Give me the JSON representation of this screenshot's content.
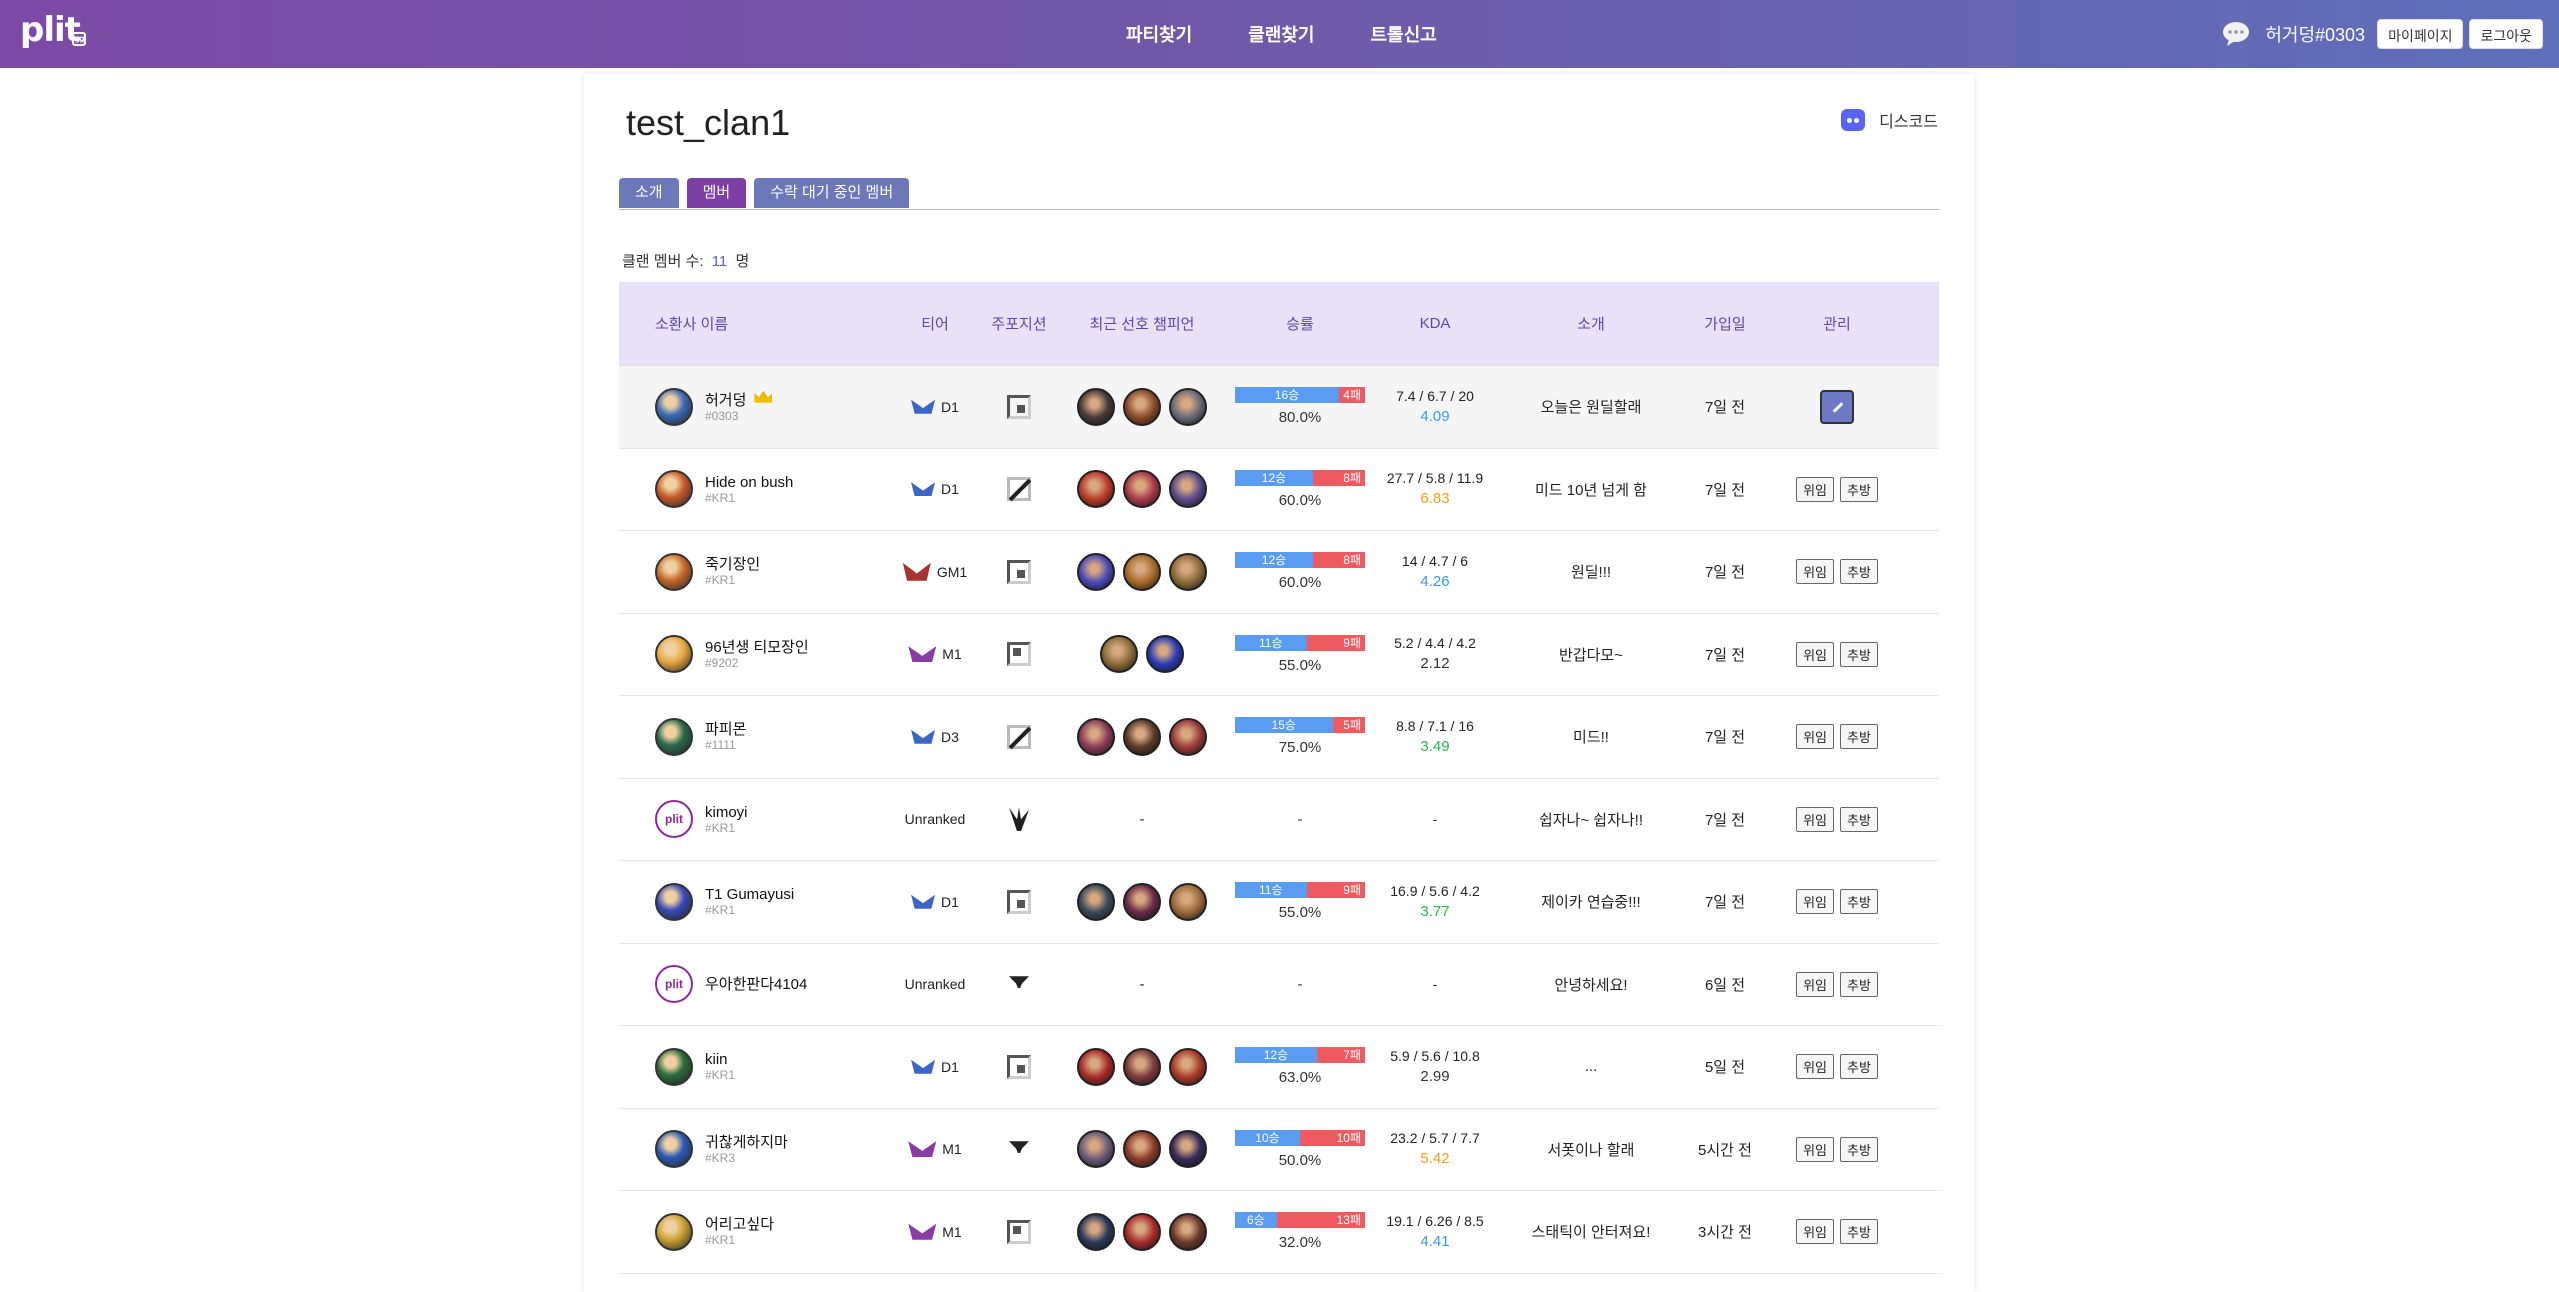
{
  "header": {
    "logo": "plit",
    "logo_sub": "gg",
    "nav": [
      "파티찾기",
      "클랜찾기",
      "트롤신고"
    ],
    "user": "허거덩#0303",
    "mypage": "마이페이지",
    "logout": "로그아웃"
  },
  "clan": {
    "title": "test_clan1",
    "discord": "디스코드",
    "tabs": [
      "소개",
      "멤버",
      "수락 대기 중인 멤버"
    ],
    "count_label": "클랜 멤버 수:",
    "count": "11",
    "count_unit": "명"
  },
  "table": {
    "headers": [
      "소환사 이름",
      "티어",
      "주포지션",
      "최근 선호 챔피언",
      "승률",
      "KDA",
      "소개",
      "가입일",
      "관리"
    ],
    "buttons": {
      "delegate": "위임",
      "kick": "추방"
    },
    "rows": [
      {
        "name": "허거덩",
        "tag": "#0303",
        "tier": "D1",
        "tier_type": "dia",
        "pos": "top",
        "champs": [
          "#4a3a3a",
          "#8a4a2a",
          "#6a6a7a"
        ],
        "win": "16승",
        "loss": "4패",
        "win_frac": 0.8,
        "rate": "80.0%",
        "kda": "7.4 / 6.7 / 20",
        "ratio": "4.09",
        "ratio_color": "#3a9ad9",
        "intro": "오늘은 원딜할래",
        "join": "7일 전",
        "owner": true,
        "avatar": "#3a6ab8"
      },
      {
        "name": "Hide on bush",
        "tag": "#KR1",
        "tier": "D1",
        "tier_type": "dia",
        "pos": "mid",
        "champs": [
          "#b83a2a",
          "#a83a4a",
          "#5a4a8a"
        ],
        "win": "12승",
        "loss": "8패",
        "win_frac": 0.6,
        "rate": "60.0%",
        "kda": "27.7 / 5.8 / 11.9",
        "ratio": "6.83",
        "ratio_color": "#f0a020",
        "intro": "미드 10년 넘게 함",
        "join": "7일 전",
        "owner": false,
        "avatar": "#c85a2a"
      },
      {
        "name": "죽기장인",
        "tag": "#KR1",
        "tier": "GM1",
        "tier_type": "gm",
        "pos": "top",
        "champs": [
          "#4a4ab8",
          "#a86a2a",
          "#8a6a3a"
        ],
        "win": "12승",
        "loss": "8패",
        "win_frac": 0.6,
        "rate": "60.0%",
        "kda": "14 / 4.7 / 6",
        "ratio": "4.26",
        "ratio_color": "#3a9ad9",
        "intro": "원딜!!!",
        "join": "7일 전",
        "owner": false,
        "avatar": "#c86a2a"
      },
      {
        "name": "96년생 티모장인",
        "tag": "#9202",
        "tier": "M1",
        "tier_type": "mas",
        "pos": "bot",
        "champs": [
          "#8a6a3a",
          "#2a3ab8"
        ],
        "win": "11승",
        "loss": "9패",
        "win_frac": 0.55,
        "rate": "55.0%",
        "kda": "5.2 / 4.4 / 4.2",
        "ratio": "2.12",
        "ratio_color": "#333333",
        "intro": "반갑다모~",
        "join": "7일 전",
        "owner": false,
        "avatar": "#e8a840"
      },
      {
        "name": "파피몬",
        "tag": "#1111",
        "tier": "D3",
        "tier_type": "dia",
        "pos": "mid",
        "champs": [
          "#8a3a5a",
          "#5a3a2a",
          "#9a3a3a"
        ],
        "win": "15승",
        "loss": "5패",
        "win_frac": 0.75,
        "rate": "75.0%",
        "kda": "8.8 / 7.1 / 16",
        "ratio": "3.49",
        "ratio_color": "#2ab84a",
        "intro": "미드!!",
        "join": "7일 전",
        "owner": false,
        "avatar": "#2a6a4a"
      },
      {
        "name": "kimoyi",
        "tag": "#KR1",
        "tier": "Unranked",
        "tier_type": "none",
        "pos": "jg",
        "champs": [],
        "win": "",
        "loss": "",
        "win_frac": 0,
        "rate": "-",
        "kda": "-",
        "ratio": "",
        "ratio_color": "#333333",
        "intro": "쉽자나~ 쉽자나!!",
        "join": "7일 전",
        "owner": false,
        "avatar": "plit",
        "champ_dash": "-"
      },
      {
        "name": "T1 Gumayusi",
        "tag": "#KR1",
        "tier": "D1",
        "tier_type": "dia",
        "pos": "top",
        "champs": [
          "#3a4a5a",
          "#6a2a4a",
          "#9a6a3a"
        ],
        "win": "11승",
        "loss": "9패",
        "win_frac": 0.55,
        "rate": "55.0%",
        "kda": "16.9 / 5.6 / 4.2",
        "ratio": "3.77",
        "ratio_color": "#2ab84a",
        "intro": "제이카 연습중!!!",
        "join": "7일 전",
        "owner": false,
        "avatar": "#3a4ab8"
      },
      {
        "name": "우아한판다4104",
        "tag": "",
        "tier": "Unranked",
        "tier_type": "none",
        "pos": "sup",
        "champs": [],
        "win": "",
        "loss": "",
        "win_frac": 0,
        "rate": "-",
        "kda": "-",
        "ratio": "",
        "ratio_color": "#333333",
        "intro": "안녕하세요!",
        "join": "6일 전",
        "owner": false,
        "avatar": "plit",
        "champ_dash": "-"
      },
      {
        "name": "kiin",
        "tag": "#KR1",
        "tier": "D1",
        "tier_type": "dia",
        "pos": "top",
        "champs": [
          "#a82a2a",
          "#7a3a3a",
          "#a83a2a"
        ],
        "win": "12승",
        "loss": "7패",
        "win_frac": 0.63,
        "rate": "63.0%",
        "kda": "5.9 / 5.6 / 10.8",
        "ratio": "2.99",
        "ratio_color": "#333333",
        "intro": "...",
        "join": "5일 전",
        "owner": false,
        "avatar": "#2a6a3a"
      },
      {
        "name": "귀찮게하지마",
        "tag": "#KR3",
        "tier": "M1",
        "tier_type": "mas",
        "pos": "sup",
        "champs": [
          "#6a5a7a",
          "#8a3a2a",
          "#3a2a5a"
        ],
        "win": "10승",
        "loss": "10패",
        "win_frac": 0.5,
        "rate": "50.0%",
        "kda": "23.2 / 5.7 / 7.7",
        "ratio": "5.42",
        "ratio_color": "#f0a020",
        "intro": "서폿이나 할래",
        "join": "5시간 전",
        "owner": false,
        "avatar": "#2a5ab8"
      },
      {
        "name": "어리고싶다",
        "tag": "#KR1",
        "tier": "M1",
        "tier_type": "mas",
        "pos": "bot",
        "champs": [
          "#2a3a5a",
          "#a82a2a",
          "#6a3a2a"
        ],
        "win": "6승",
        "loss": "13패",
        "win_frac": 0.32,
        "rate": "32.0%",
        "kda": "19.1 / 6.26 / 8.5",
        "ratio": "4.41",
        "ratio_color": "#3a9ad9",
        "intro": "스태틱이 안터져요!",
        "join": "3시간 전",
        "owner": false,
        "avatar": "#c8a030"
      }
    ]
  }
}
